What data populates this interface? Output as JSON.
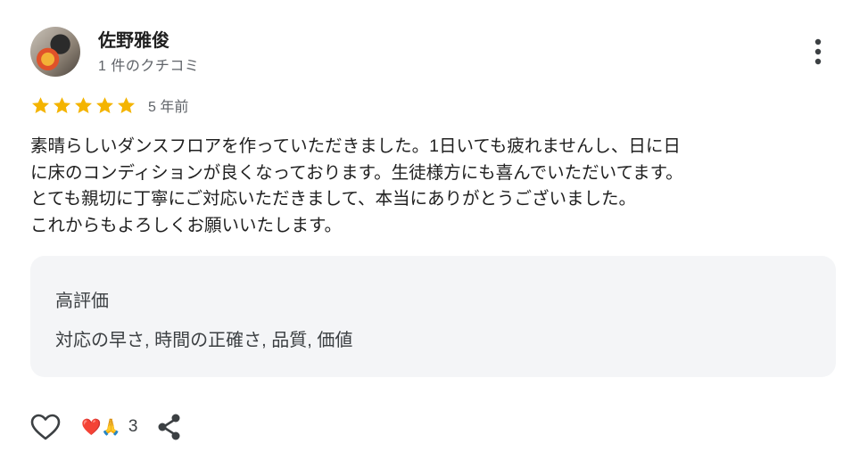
{
  "reviewer": {
    "name": "佐野雅俊",
    "review_count": "1 件のクチコミ"
  },
  "rating": {
    "stars": 5,
    "max": 5,
    "date": "5 年前"
  },
  "review": {
    "text": "素晴らしいダンスフロアを作っていただきました。1日いても疲れませんし、日に日\nに床のコンディションが良くなっております。生徒様方にも喜んでいただいてます。\nとても親切に丁寧にご対応いただきまして、本当にありがとうございました。\nこれからもよろしくお願いいたします。"
  },
  "details": {
    "title": "高評価",
    "value": "対応の早さ, 時間の正確さ, 品質, 価値"
  },
  "actions": {
    "reactions": "❤️🙏",
    "reaction_count": "3"
  },
  "colors": {
    "star": "#f4b400",
    "details_bg": "#f4f5f7",
    "icon": "#3c4043"
  },
  "icons": [
    "more-vert-icon",
    "star-icon",
    "heart-outline-icon",
    "share-icon"
  ]
}
